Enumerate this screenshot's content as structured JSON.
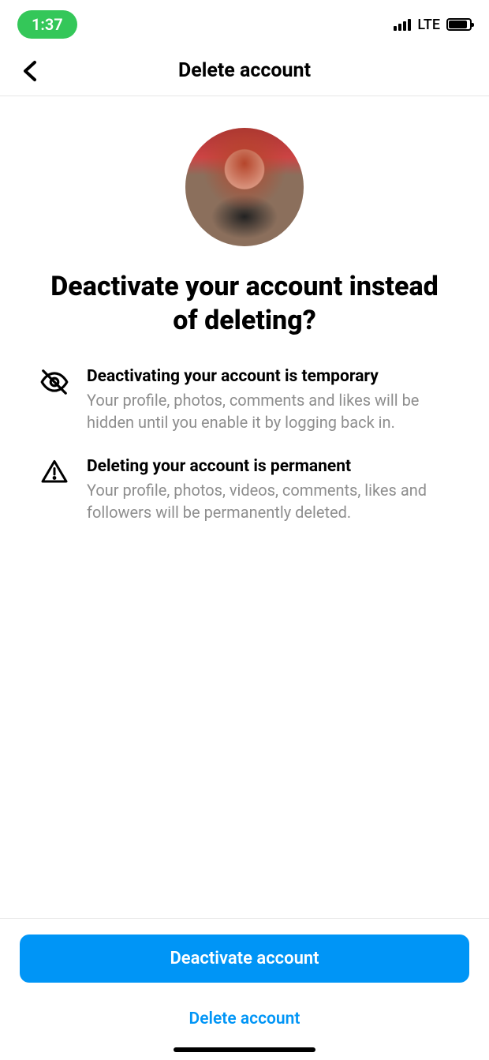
{
  "status": {
    "time": "1:37",
    "network": "LTE"
  },
  "nav": {
    "title": "Delete account"
  },
  "main": {
    "headline": "Deactivate your account instead of deleting?",
    "sections": [
      {
        "title": "Deactivating your account is temporary",
        "desc": "Your profile, photos, comments and likes will be hidden until you enable it by logging back in."
      },
      {
        "title": "Deleting your account is permanent",
        "desc": "Your profile, photos, videos, comments, likes and followers will be permanently deleted."
      }
    ]
  },
  "footer": {
    "primary": "Deactivate account",
    "secondary": "Delete account"
  }
}
